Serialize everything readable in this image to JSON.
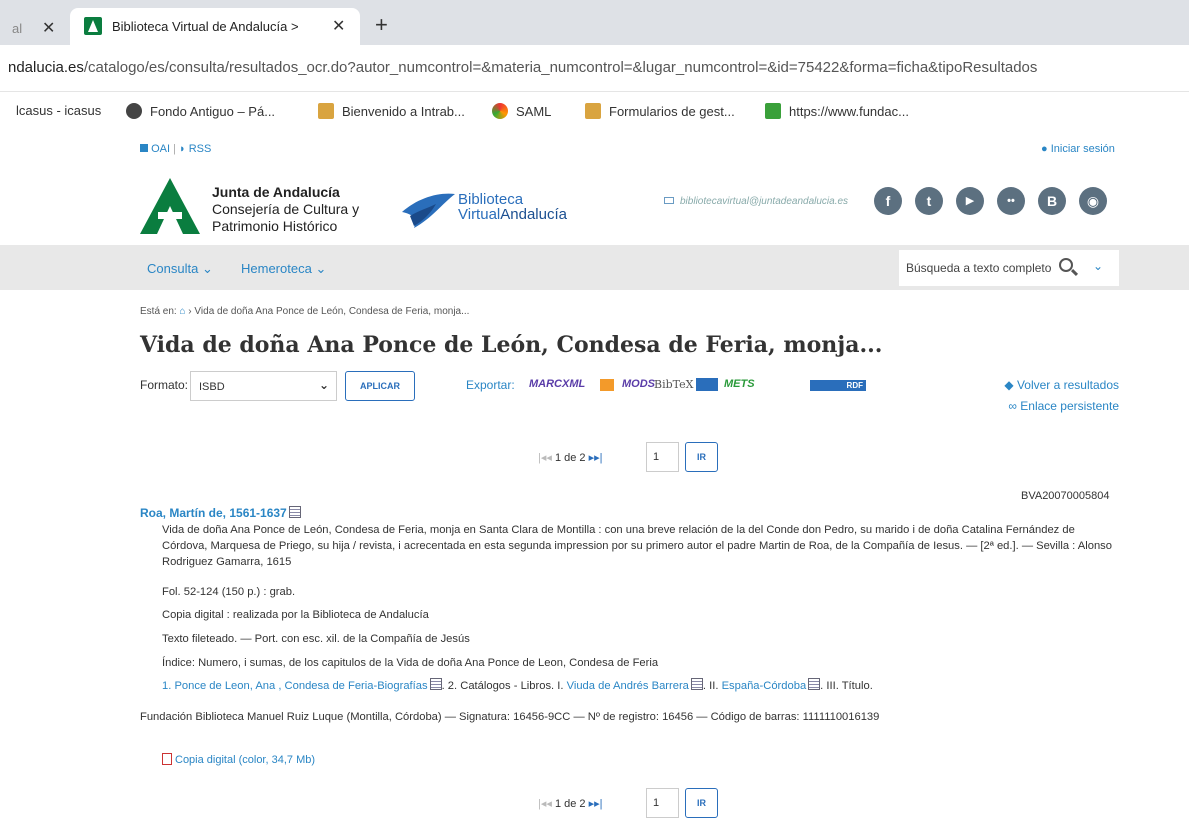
{
  "browser": {
    "prev_tab_label": "al",
    "active_tab_title": "Biblioteca Virtual de Andalucía >",
    "close_glyph": "✕",
    "new_tab_glyph": "+",
    "url_domain": "ndalucia.es",
    "url_path": "/catalogo/es/consulta/resultados_ocr.do?autor_numcontrol=&materia_numcontrol=&lugar_numcontrol=&id=75422&forma=ficha&tipoResultados",
    "bookmarks": [
      "lcasus - icasus",
      "Fondo Antiguo – Pá...",
      "Bienvenido a Intrab...",
      "SAML",
      "Formularios de gest...",
      "https://www.fundac..."
    ]
  },
  "header": {
    "oai": "OAI",
    "rss": "RSS",
    "separator": "|",
    "login": "Iniciar sesión",
    "junta_line1": "Junta de Andalucía",
    "junta_line2": "Consejería de Cultura y",
    "junta_line3": "Patrimonio Histórico",
    "bva_line1": "Biblioteca",
    "bva_line2a": "Virtual",
    "bva_line2b": "Andalucía",
    "email": "bibliotecavirtual@juntadeandalucia.es",
    "social_icons": [
      "facebook-icon",
      "twitter-icon",
      "youtube-icon",
      "flickr-icon",
      "blogger-icon",
      "rss-icon"
    ],
    "social_glyphs": [
      "f",
      "t",
      "▶",
      "••",
      "B",
      "◉"
    ]
  },
  "nav": {
    "items": [
      "Consulta",
      "Hemeroteca"
    ],
    "search_placeholder": "Búsqueda a texto completo"
  },
  "record": {
    "breadcrumb_label": "Está en:",
    "breadcrumb_item": "Vida de doña Ana Ponce de León, Condesa de Feria, monja...",
    "title": "Vida de doña Ana Ponce de León, Condesa de Feria, monja...",
    "format_label": "Formato:",
    "format_value": "ISBD",
    "apply_label": "APLICAR",
    "export_label": "Exportar:",
    "exports": [
      "MARCXML",
      "MODS",
      "BibTeX",
      "METS",
      "RDF"
    ],
    "back_link": "Volver a resultados",
    "permalink": "Enlace persistente",
    "pager_text": "1 de 2",
    "pager_value": "1",
    "go_label": "IR",
    "record_id": "BVA20070005804",
    "author": "Roa, Martín de, 1561-1637",
    "description": "Vida de doña Ana Ponce de León, Condesa de Feria, monja en Santa Clara de Montilla : con una breve relación de la del Conde don Pedro, su marido i de doña Catalina Fernández de Córdova, Marquesa de Priego, su hija / revista, i acrecentada en esta segunda impression por su primero autor el padre Martin de Roa, de la Compañía de Iesus. — [2ª ed.]. — Sevilla : Alonso Rodriguez Gamarra, 1615",
    "physical": "Fol. 52-124 (150 p.) : grab.",
    "note1": "Copia digital : realizada por la Biblioteca de Andalucía",
    "note2": "Texto fileteado. — Port. con esc. xil. de la Compañía de Jesús",
    "note3": "Índice: Numero, i sumas, de los capitulos de la Vida de doña Ana Ponce de Leon, Condesa de Feria",
    "subjects": {
      "n1": "1.",
      "s1": "Ponce de Leon, Ana , Condesa de Feria-Biografías",
      "n2": ". 2. Catálogos - Libros. I.",
      "s2": "Viuda de Andrés Barrera",
      "n3": ". II.",
      "s3": "España-Córdoba",
      "n4": ". III. Título."
    },
    "holdings": "Fundación Biblioteca Manuel Ruiz Luque (Montilla, Córdoba) — Signatura: 16456-9CC — Nº de registro: 16456 — Código de barras: 1111110016139",
    "pdf_link": "Copia digital (color, 34,7 Mb)"
  }
}
